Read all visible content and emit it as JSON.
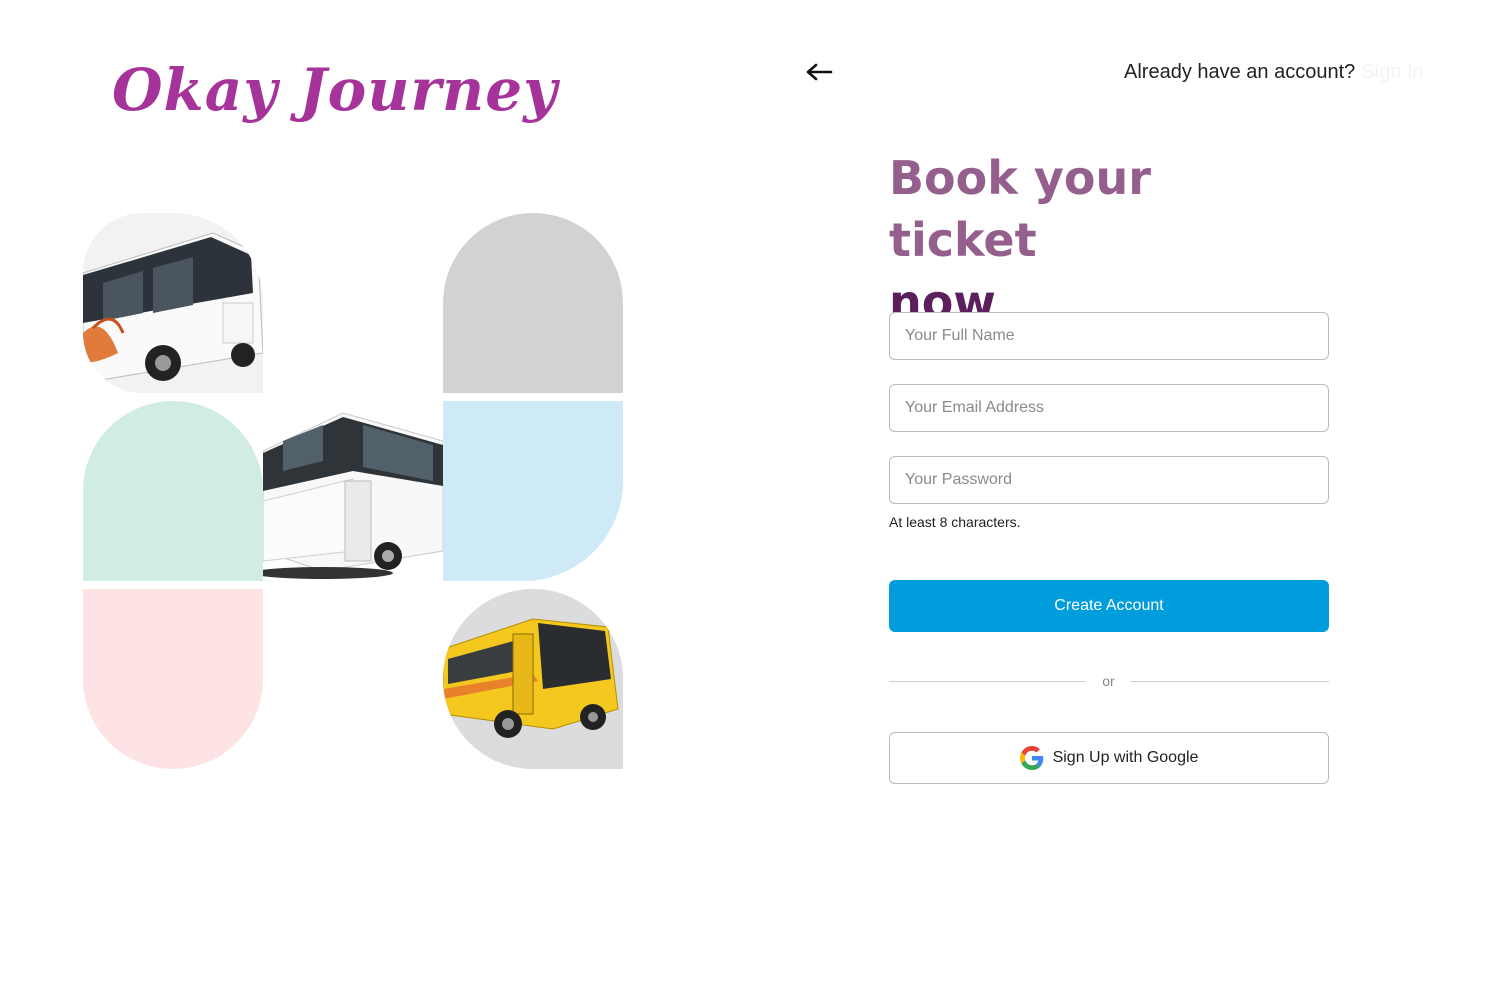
{
  "brand": {
    "logo_text": "Okay Journey"
  },
  "header": {
    "back_icon": "arrow-left-icon",
    "already_text": "Already have an account?",
    "signin_label": "Sign In"
  },
  "heading": {
    "line1": "Book your ticket",
    "line2": "now"
  },
  "form": {
    "full_name_placeholder": "Your Full Name",
    "email_placeholder": "Your Email Address",
    "password_placeholder": "Your Password",
    "password_hint": "At least 8 characters.",
    "create_label": "Create Account",
    "or_text": "or",
    "google_label": "Sign Up with Google",
    "google_icon": "google-icon"
  },
  "colors": {
    "brand": "#a6339a",
    "heading_light": "#955f8d",
    "heading_dark": "#5a1f5c",
    "primary_button": "#009ddd",
    "tile_grey": "#d2d2d4",
    "tile_mint": "#d0ece3",
    "tile_sky": "#cdeaf6",
    "tile_pink": "#fde3e3"
  }
}
